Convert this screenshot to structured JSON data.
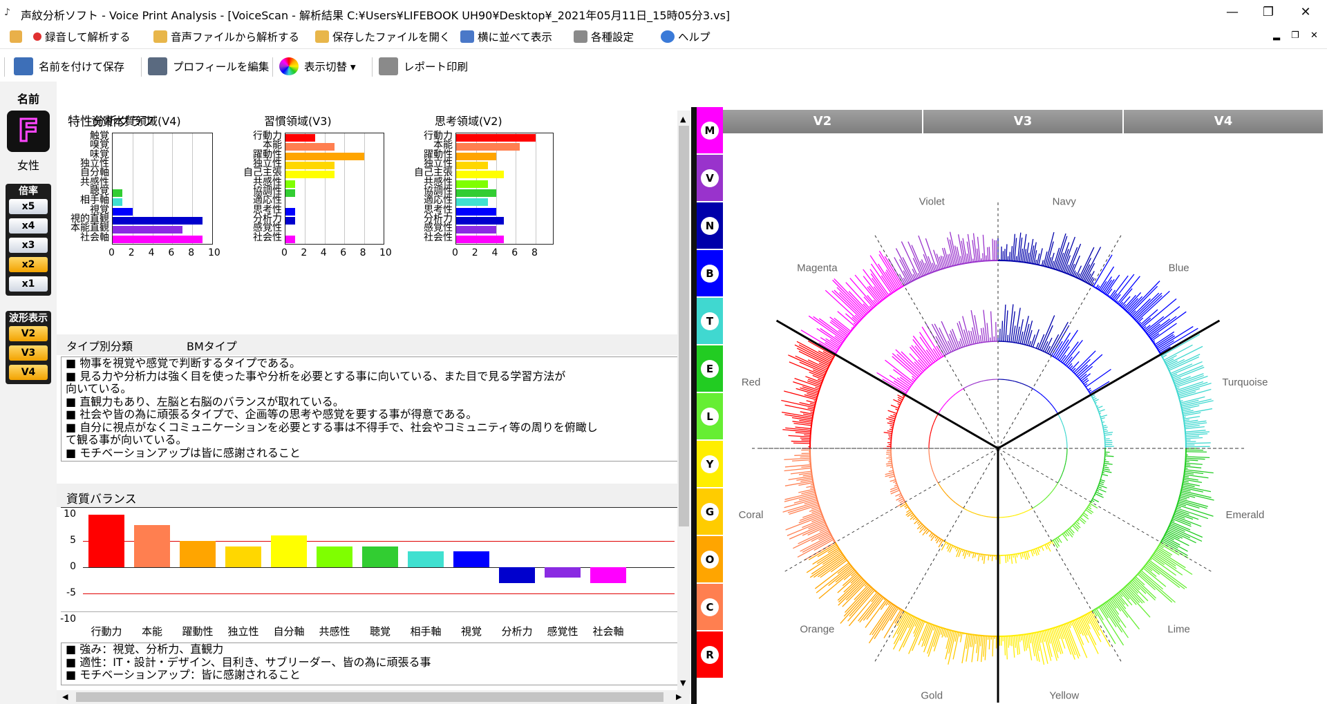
{
  "window": {
    "title": "声紋分析ソフト - Voice Print Analysis - [VoiceScan - 解析結果 C:¥Users¥LIFEBOOK UH90¥Desktop¥_2021年05月11日_15時05分3.vs]",
    "minimize": "—",
    "restore": "❐",
    "close": "✕"
  },
  "menu": {
    "items": [
      {
        "label": "録音して解析する",
        "icon": "record-icon",
        "color": "#e03030"
      },
      {
        "label": "音声ファイルから解析する",
        "icon": "folder-icon",
        "color": "#e8b64a"
      },
      {
        "label": "保存したファイルを開く",
        "icon": "folder-open-icon",
        "color": "#e8b64a"
      },
      {
        "label": "横に並べて表示",
        "icon": "tile-icon",
        "color": "#4a78c8"
      },
      {
        "label": "各種設定",
        "icon": "settings-icon",
        "color": "#7a7a7a"
      },
      {
        "label": "ヘルプ",
        "icon": "help-icon",
        "color": "#3a7ad8"
      }
    ],
    "mdi": [
      "▂",
      "❐",
      "✕"
    ]
  },
  "toolbar": {
    "items": [
      {
        "label": "名前を付けて保存",
        "icon": "save-icon",
        "color": "#3d6fb8"
      },
      {
        "label": "プロフィールを編集",
        "icon": "profile-icon",
        "color": "#5a6a80"
      },
      {
        "label": "表示切替 ▾",
        "icon": "display-toggle-icon",
        "color": "#d07a30"
      },
      {
        "label": "レポート印刷",
        "icon": "print-icon",
        "color": "#8a8a8a"
      }
    ]
  },
  "profile": {
    "name_label": "名前",
    "initial": "F",
    "gender": "女性"
  },
  "magnification": {
    "title": "倍率",
    "buttons": [
      {
        "label": "x5",
        "active": false
      },
      {
        "label": "x4",
        "active": false
      },
      {
        "label": "x3",
        "active": false
      },
      {
        "label": "x2",
        "active": true
      },
      {
        "label": "x1",
        "active": false
      }
    ]
  },
  "waveform": {
    "title": "波形表示",
    "buttons": [
      "V2",
      "V3",
      "V4"
    ]
  },
  "analysis": {
    "heading": "特性分析グラフ",
    "charts": [
      {
        "title": "資質本質領域(V4)",
        "labels": [
          "触覚",
          "嗅覚",
          "味覚",
          "独立性",
          "自分軸",
          "共感性",
          "聴覚",
          "相手軸",
          "視覚",
          "視的直観",
          "本能直観",
          "社会軸"
        ],
        "values": [
          0,
          0,
          0,
          0,
          0,
          0,
          1,
          1,
          2,
          9,
          7,
          9
        ],
        "colors": [
          "#ff0000",
          "#ff7f50",
          "#ffa500",
          "#ffd700",
          "#ffff00",
          "#7fff00",
          "#32cd32",
          "#40e0d0",
          "#0000ff",
          "#0000cd",
          "#8a2be2",
          "#ff00ff"
        ],
        "ticks": [
          "0",
          "2",
          "4",
          "6",
          "8",
          "10"
        ],
        "max": 10
      },
      {
        "title": "習慣領域(V3)",
        "labels": [
          "行動力",
          "本能",
          "躍動性",
          "独立性",
          "自己主張",
          "共感性",
          "協調性",
          "適応性",
          "思考性",
          "分析力",
          "感覚性",
          "社会性"
        ],
        "values": [
          3,
          5,
          8,
          5,
          5,
          1,
          1,
          0,
          1,
          1,
          0,
          1
        ],
        "colors": [
          "#ff0000",
          "#ff7f50",
          "#ffa500",
          "#ffd700",
          "#ffff00",
          "#7fff00",
          "#32cd32",
          "#40e0d0",
          "#0000ff",
          "#0000cd",
          "#8a2be2",
          "#ff00ff"
        ],
        "ticks": [
          "0",
          "2",
          "4",
          "6",
          "8",
          "10"
        ],
        "max": 10
      },
      {
        "title": "思考領域(V2)",
        "labels": [
          "行動力",
          "本能",
          "躍動性",
          "独立性",
          "自己主張",
          "共感性",
          "協調性",
          "適応性",
          "思考性",
          "分析力",
          "感覚性",
          "社会性"
        ],
        "values": [
          10,
          8,
          5,
          4,
          6,
          4,
          5,
          4,
          5,
          6,
          5,
          6
        ],
        "colors": [
          "#ff0000",
          "#ff7f50",
          "#ffa500",
          "#ffd700",
          "#ffff00",
          "#7fff00",
          "#32cd32",
          "#40e0d0",
          "#0000ff",
          "#0000cd",
          "#8a2be2",
          "#ff00ff"
        ],
        "ticks": [
          "0",
          "2",
          "4",
          "6",
          "8"
        ],
        "max": 10
      }
    ],
    "type_label": "タイプ別分類",
    "type_value": "BMタイプ",
    "description": [
      "■ 物事を視覚や感覚で判断するタイプである。",
      "■ 見る力や分析力は強く目を使った事や分析を必要とする事に向いている、また目で見る学習方法が",
      "向いている。",
      "■ 直観力もあり、左脳と右脳のバランスが取れている。",
      "■ 社会や皆の為に頑張るタイプで、企画等の思考や感覚を要する事が得意である。",
      "■ 自分に視点がなくコミュニケーションを必要とする事は不得手で、社会やコミュニティ等の周りを俯瞰し",
      "て観る事が向いている。",
      "■ モチベーションアップは皆に感謝されること"
    ],
    "balance_label": "資質バランス",
    "balance": {
      "categories": [
        "行動力",
        "本能",
        "躍動性",
        "独立性",
        "自分軸",
        "共感性",
        "聴覚",
        "相手軸",
        "視覚",
        "分析力",
        "感覚性",
        "社会軸"
      ],
      "values": [
        10,
        8,
        5,
        4,
        6,
        4,
        4,
        3,
        3,
        -3,
        -2,
        -3
      ],
      "colors": [
        "#ff0000",
        "#ff7f50",
        "#ffa500",
        "#ffd700",
        "#ffff00",
        "#7fff00",
        "#32cd32",
        "#40e0d0",
        "#0000ff",
        "#0000cd",
        "#8a2be2",
        "#ff00ff"
      ],
      "yticks": [
        "10",
        "5",
        "0",
        "-5",
        "-10"
      ],
      "ylim": [
        -10,
        10
      ],
      "ref_lines": [
        5,
        -5
      ]
    },
    "summary": [
      "■ 強み：視覚、分析力、直観力",
      "■ 適性：IT・設計・デザイン、目利き、サブリーダー、皆の為に頑張る事",
      "■ モチベーションアップ：皆に感謝されること"
    ]
  },
  "scroll": {
    "up": "▲",
    "down": "▼",
    "left": "◀",
    "right": "▶"
  },
  "voiceprint": {
    "headers": [
      "V2",
      "V3",
      "V4"
    ],
    "color_bands": [
      {
        "letter": "M",
        "color": "#ff00ff"
      },
      {
        "letter": "V",
        "color": "#9933cc"
      },
      {
        "letter": "N",
        "color": "#0000aa"
      },
      {
        "letter": "B",
        "color": "#0000ff"
      },
      {
        "letter": "T",
        "color": "#40d8d0"
      },
      {
        "letter": "E",
        "color": "#22cc22"
      },
      {
        "letter": "L",
        "color": "#66ee33"
      },
      {
        "letter": "Y",
        "color": "#ffee00"
      },
      {
        "letter": "G",
        "color": "#ffcc00"
      },
      {
        "letter": "O",
        "color": "#ffa500"
      },
      {
        "letter": "C",
        "color": "#ff7f50"
      },
      {
        "letter": "R",
        "color": "#ff0000"
      }
    ],
    "wheel_labels": [
      {
        "name": "Violet",
        "ang": -15,
        "color": "#9933cc"
      },
      {
        "name": "Navy",
        "ang": 15,
        "color": "#0000aa"
      },
      {
        "name": "Blue",
        "ang": 45,
        "color": "#0000ff"
      },
      {
        "name": "Turquoise",
        "ang": 75,
        "color": "#40d8d0"
      },
      {
        "name": "Emerald",
        "ang": 105,
        "color": "#22cc22"
      },
      {
        "name": "Lime",
        "ang": 135,
        "color": "#66ee33"
      },
      {
        "name": "Yellow",
        "ang": 165,
        "color": "#ffee00"
      },
      {
        "name": "Gold",
        "ang": 195,
        "color": "#ffcc00"
      },
      {
        "name": "Orange",
        "ang": 225,
        "color": "#ffa500"
      },
      {
        "name": "Coral",
        "ang": 255,
        "color": "#ff7f50"
      },
      {
        "name": "Red",
        "ang": 285,
        "color": "#ff0000"
      },
      {
        "name": "Magenta",
        "ang": 315,
        "color": "#ff00ff"
      }
    ]
  }
}
